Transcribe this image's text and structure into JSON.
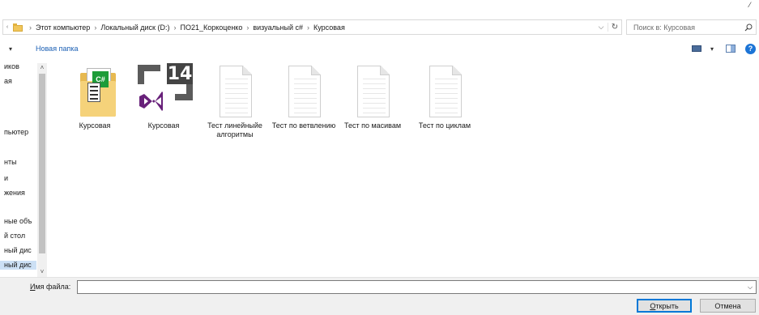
{
  "address_bar": {
    "breadcrumbs": [
      "Этот компьютер",
      "Локальный диск (D:)",
      "ПО21_Коркоценко",
      "визуальный с#",
      "Курсовая"
    ]
  },
  "search": {
    "placeholder": "Поиск в: Курсовая"
  },
  "toolbar": {
    "new_folder_label": "Новая папка"
  },
  "nav_pane": {
    "items": [
      "иков",
      "ая",
      "пьютер",
      "нты",
      "и",
      "жения",
      "ные объ",
      "й стол",
      "ный дис",
      "ный дис"
    ],
    "selected_index": 9
  },
  "files": [
    {
      "label": "Курсовая",
      "icon": "folder-project-icon"
    },
    {
      "label": "Курсовая",
      "icon": "visual-studio-icon"
    },
    {
      "label": "Тест линейныйе алгоритмы",
      "icon": "document-icon"
    },
    {
      "label": "Тест по ветвлению",
      "icon": "document-icon"
    },
    {
      "label": "Тест по масивам",
      "icon": "document-icon"
    },
    {
      "label": "Тест по циклам",
      "icon": "document-icon"
    }
  ],
  "vs_badge_text": "14",
  "cs_badge_text": "C#",
  "filename": {
    "label_underlined": "И",
    "label_rest": "мя файла:",
    "value": ""
  },
  "buttons": {
    "open_underlined": "О",
    "open_rest": "ткрыть",
    "cancel": "Отмена"
  },
  "colors": {
    "link_blue": "#1a5fb4",
    "help_blue": "#1c74d6",
    "folder_yellow": "#f5d27a",
    "cs_green": "#1d9c39",
    "vs_purple": "#68217a",
    "selection": "#cce0f5"
  }
}
